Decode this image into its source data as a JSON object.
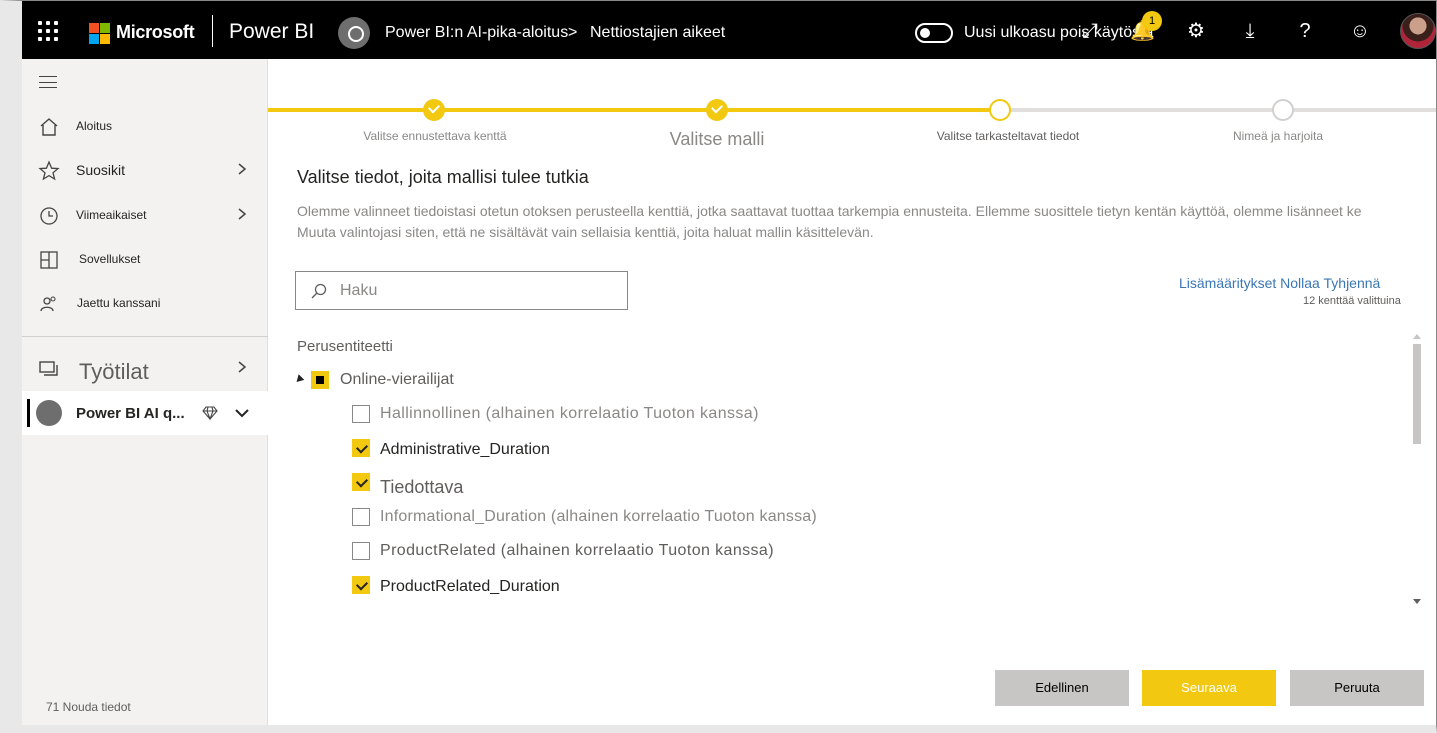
{
  "topbar": {
    "brand": "Microsoft",
    "app": "Power BI",
    "breadcrumb_workspace": "Power BI:n AI-pika-aloitus",
    "breadcrumb_separator": ">",
    "breadcrumb_item": "Nettiostajien aikeet",
    "toggle_label": "Uusi ulkoasu pois käytöstä",
    "notification_count": "1"
  },
  "sidebar": {
    "items": [
      {
        "label": "Aloitus",
        "icon": "home-icon"
      },
      {
        "label": "Suosikit",
        "icon": "star-icon"
      },
      {
        "label": "Viimeaikaiset",
        "icon": "clock-icon"
      },
      {
        "label": "Sovellukset",
        "icon": "apps-icon"
      },
      {
        "label": "Jaettu kanssani",
        "icon": "shared-icon"
      }
    ],
    "workspaces_label": "Työtilat",
    "current_workspace": "Power BI AI q...",
    "get_data": "71 Nouda tiedot"
  },
  "stepper": {
    "steps": [
      {
        "label": "Valitse ennustettava kenttä",
        "state": "done"
      },
      {
        "label": "Valitse malli",
        "state": "done"
      },
      {
        "label": "Valitse tarkasteltavat tiedot",
        "state": "current"
      },
      {
        "label": "Nimeä ja harjoita",
        "state": "todo"
      }
    ]
  },
  "content": {
    "title": "Valitse tiedot, joita mallisi tulee tutkia",
    "description_line1": "Olemme valinneet tiedoistasi otetun otoksen perusteella kenttiä, jotka saattavat tuottaa tarkempia ennusteita. Ellemme suosittele tietyn kentän käyttöä, olemme lisänneet ke",
    "description_line2": "Muuta valintojasi siten, että ne sisältävät vain sellaisia kenttiä, joita haluat mallin käsittelevän.",
    "search_placeholder": "Haku",
    "action_advanced": "Lisämääritykset",
    "action_reset": "Nollaa",
    "action_clear": "Tyhjennä",
    "selected_count": "12 kenttää valittuina",
    "entity_heading": "Perusentiteetti",
    "entity_name": "Online-vierailijat",
    "fields": [
      {
        "label": "Hallinnollinen (alhainen korrelaatio Tuoton kanssa)",
        "checked": false
      },
      {
        "label": "Administrative_Duration",
        "checked": true
      },
      {
        "label": "Tiedottava",
        "checked": true
      },
      {
        "label": "Informational_Duration (alhainen korrelaatio Tuoton kanssa)",
        "checked": false
      },
      {
        "label": "ProductRelated (alhainen korrelaatio Tuoton kanssa)",
        "checked": false
      },
      {
        "label": "ProductRelated_Duration",
        "checked": true
      }
    ]
  },
  "buttons": {
    "previous": "Edellinen",
    "next": "Seuraava",
    "cancel": "Peruuta"
  },
  "colors": {
    "accent": "#f2c811",
    "topbar": "#000000",
    "link": "#3a77b3"
  }
}
